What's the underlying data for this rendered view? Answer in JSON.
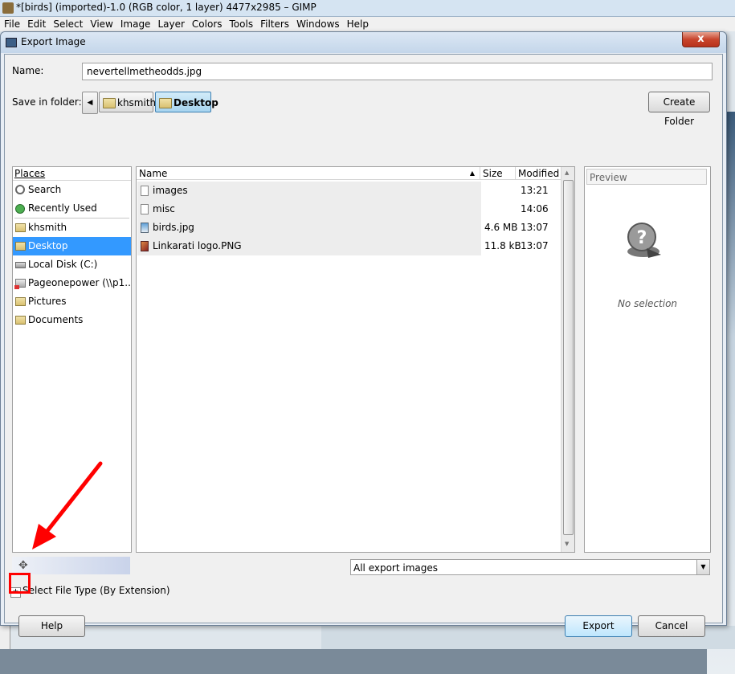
{
  "app": {
    "window_title": "*[birds] (imported)-1.0 (RGB color, 1 layer) 4477x2985 – GIMP",
    "menu": [
      "File",
      "Edit",
      "Select",
      "View",
      "Image",
      "Layer",
      "Colors",
      "Tools",
      "Filters",
      "Windows",
      "Help"
    ]
  },
  "dialog": {
    "title": "Export Image",
    "close_label": "x",
    "name_label": "Name:",
    "name_value": "nevertellmetheodds.jpg",
    "save_in_label": "Save in folder:",
    "breadcrumbs": [
      "khsmith",
      "Desktop"
    ],
    "create_folder_label": "Create Folder",
    "places_header": "Places",
    "places": [
      {
        "label": "Search",
        "icon": "search-icon"
      },
      {
        "label": "Recently Used",
        "icon": "recently-used-icon"
      },
      {
        "label": "khsmith",
        "icon": "folder-icon"
      },
      {
        "label": "Desktop",
        "icon": "folder-icon",
        "selected": true
      },
      {
        "label": "Local Disk (C:)",
        "icon": "drive-icon"
      },
      {
        "label": "Pageonepower (\\\\p1...",
        "icon": "network-drive-icon"
      },
      {
        "label": "Pictures",
        "icon": "folder-icon"
      },
      {
        "label": "Documents",
        "icon": "folder-icon"
      }
    ],
    "columns": {
      "name": "Name",
      "size": "Size",
      "modified": "Modified"
    },
    "files": [
      {
        "name": "images",
        "size": "",
        "modified": "13:21",
        "icon": "folder-doc-icon"
      },
      {
        "name": "misc",
        "size": "",
        "modified": "14:06",
        "icon": "folder-doc-icon"
      },
      {
        "name": "birds.jpg",
        "size": "4.6 MB",
        "modified": "13:07",
        "icon": "image-file-icon"
      },
      {
        "name": "Linkarati logo.PNG",
        "size": "11.8 kB",
        "modified": "13:07",
        "icon": "png-file-icon"
      }
    ],
    "preview_header": "Preview",
    "preview_empty": "No selection",
    "filter_value": "All export images",
    "file_type_label": "Select File Type (By Extension)",
    "help_label": "Help",
    "export_label": "Export",
    "cancel_label": "Cancel"
  },
  "colors": {
    "selection": "#3399ff",
    "annotation_red": "#ff0000"
  }
}
